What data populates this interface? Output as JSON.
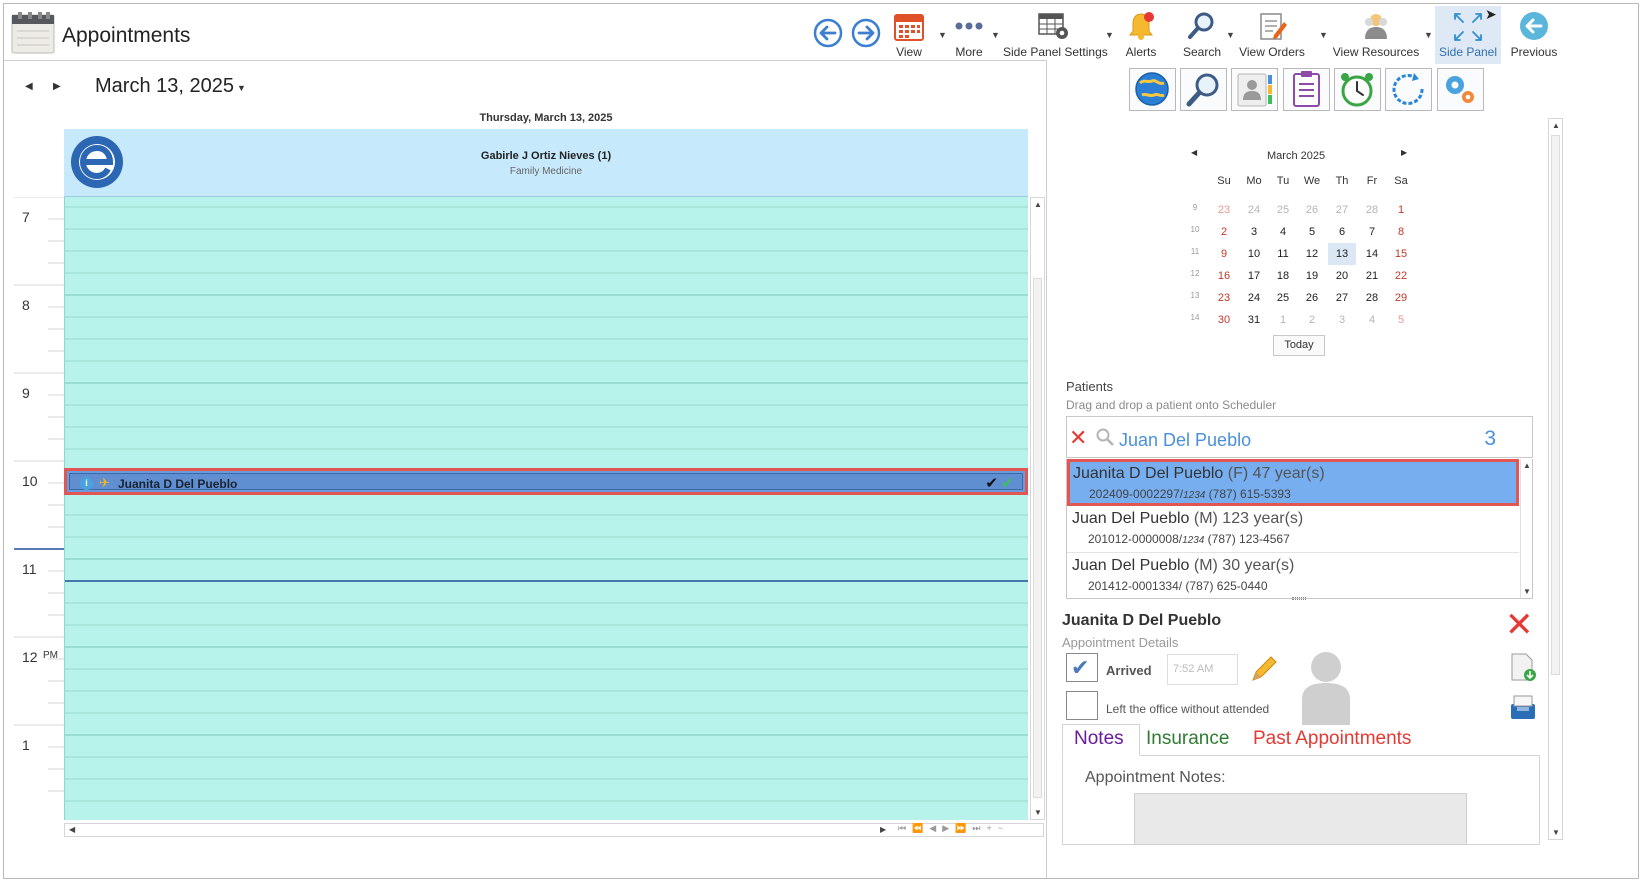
{
  "header": {
    "title": "Appointments",
    "toolbar": {
      "view": "View",
      "more": "More",
      "side_panel_settings": "Side Panel Settings",
      "alerts": "Alerts",
      "search": "Search",
      "view_orders": "View Orders",
      "view_resources": "View Resources",
      "side_panel": "Side Panel",
      "previous": "Previous"
    }
  },
  "scheduler": {
    "date": "March 13, 2025",
    "day_title": "Thursday, March 13, 2025",
    "resource_name": "Gabirle J Ortiz Nieves (1)",
    "resource_specialty": "Family Medicine",
    "hours": [
      "7",
      "8",
      "9",
      "10",
      "11",
      "12",
      "1"
    ],
    "pm_label": "PM",
    "appointment": {
      "patient": "Juanita D Del Pueblo",
      "hour": "10:00"
    },
    "current_time_hour": "11"
  },
  "mini_calendar": {
    "title": "March 2025",
    "weekdays": [
      "Su",
      "Mo",
      "Tu",
      "We",
      "Th",
      "Fr",
      "Sa"
    ],
    "weeks": [
      {
        "num": "9",
        "days": [
          "23",
          "24",
          "25",
          "26",
          "27",
          "28",
          "1"
        ]
      },
      {
        "num": "10",
        "days": [
          "2",
          "3",
          "4",
          "5",
          "6",
          "7",
          "8"
        ]
      },
      {
        "num": "11",
        "days": [
          "9",
          "10",
          "11",
          "12",
          "13",
          "14",
          "15"
        ]
      },
      {
        "num": "12",
        "days": [
          "16",
          "17",
          "18",
          "19",
          "20",
          "21",
          "22"
        ]
      },
      {
        "num": "13",
        "days": [
          "23",
          "24",
          "25",
          "26",
          "27",
          "28",
          "29"
        ]
      },
      {
        "num": "14",
        "days": [
          "30",
          "31",
          "1",
          "2",
          "3",
          "4",
          "5"
        ]
      }
    ],
    "selected_day": "13",
    "today_label": "Today",
    "colors": {
      "weekend": "#c0392b",
      "other_month": "#b5b5b5",
      "selected_bg": "#dbe7f5"
    }
  },
  "patients": {
    "title": "Patients",
    "subtitle": "Drag and drop a patient onto Scheduler",
    "search_value": "Juan Del Pueblo",
    "result_count": "3",
    "results": [
      {
        "name": "Juanita D Del Pueblo",
        "meta": "(F) 47 year(s)",
        "id": "202409-0002297/",
        "code": "1234",
        "phone": " (787) 615-5393"
      },
      {
        "name": "Juan Del Pueblo",
        "meta": "(M) 123 year(s)",
        "id": "201012-0000008/",
        "code": "1234",
        "phone": " (787) 123-4567"
      },
      {
        "name": "Juan Del Pueblo",
        "meta": "(M) 30 year(s)",
        "id": "201412-0001334/",
        "code": "",
        "phone": " (787) 625-0440"
      }
    ]
  },
  "details": {
    "patient_name": "Juanita D Del Pueblo",
    "subtitle": "Appointment Details",
    "arrived_label": "Arrived",
    "arrived_checked": true,
    "arrived_time": "7:52 AM",
    "left_label": "Left the office without attended",
    "left_checked": false,
    "tabs": [
      "Notes",
      "Insurance",
      "Past Appointments"
    ],
    "notes_label": "Appointment Notes:",
    "tab_colors": {
      "notes": "#6a1b9a",
      "insurance": "#2e7d32",
      "past": "#e53935"
    }
  },
  "colors": {
    "accent": "#4a90d9",
    "grid": "#b7f3ea",
    "resource_header": "#c6e9fb",
    "selection_border": "#e15552",
    "appointment": "#5f8fd0"
  }
}
